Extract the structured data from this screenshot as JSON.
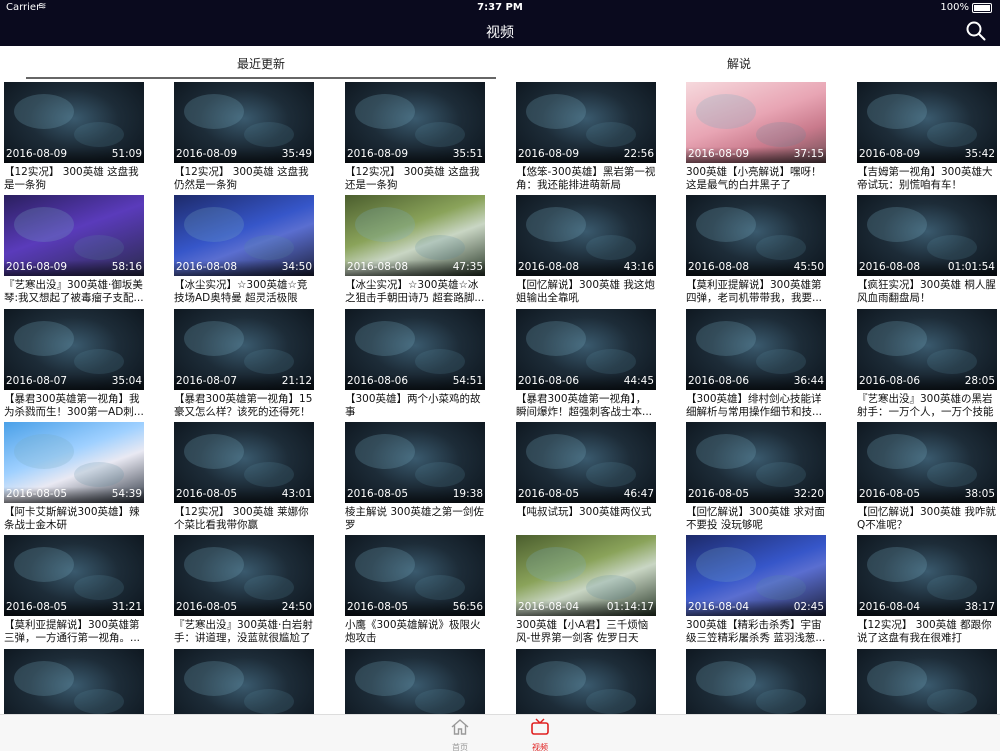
{
  "status": {
    "carrier": "Carrier",
    "time": "7:37 PM",
    "battery": "100%"
  },
  "nav": {
    "title": "视频"
  },
  "tabs": [
    {
      "label": "最近更新"
    },
    {
      "label": "解说"
    }
  ],
  "videos": [
    {
      "date": "2016-08-09",
      "duration": "51:09",
      "title": "【12实况】 300英雄 这盘我是一条狗"
    },
    {
      "date": "2016-08-09",
      "duration": "35:49",
      "title": "【12实况】 300英雄 这盘我仍然是一条狗"
    },
    {
      "date": "2016-08-09",
      "duration": "35:51",
      "title": "【12实况】 300英雄 这盘我还是一条狗"
    },
    {
      "date": "2016-08-09",
      "duration": "22:56",
      "title": "【悠笨-300英雄】黑岩第一视角：我还能排进萌新局"
    },
    {
      "date": "2016-08-09",
      "duration": "37:15",
      "title": "300英雄【小亮解说】嘿呀！这是最气的白井黑子了"
    },
    {
      "date": "2016-08-09",
      "duration": "35:42",
      "title": "【吉姆第一视角】300英雄大帝试玩：别慌咱有车！"
    },
    {
      "date": "2016-08-09",
      "duration": "58:16",
      "title": "『艺寒出没』300英雄·御坂美琴:我又想起了被毒瘤子支配..."
    },
    {
      "date": "2016-08-08",
      "duration": "34:50",
      "title": "【冰尘实况】☆300英雄☆竞技场AD奥特曼 超灵活极限秀..."
    },
    {
      "date": "2016-08-08",
      "duration": "47:35",
      "title": "【冰尘实况】☆300英雄☆冰之狙击手朝田诗乃 超套路脚..."
    },
    {
      "date": "2016-08-08",
      "duration": "43:16",
      "title": "【回忆解说】300英雄 我这炮姐输出全靠吼"
    },
    {
      "date": "2016-08-08",
      "duration": "45:50",
      "title": "【莫利亚提解说】300英雄第四弹，老司机带带我，我要..."
    },
    {
      "date": "2016-08-08",
      "duration": "01:01:54",
      "title": "【疯狂实况】300英雄 桐人腥风血雨翻盘局！"
    },
    {
      "date": "2016-08-07",
      "duration": "35:04",
      "title": "【暴君300英雄第一视角】我为杀戮而生！300第一AD刺..."
    },
    {
      "date": "2016-08-07",
      "duration": "21:12",
      "title": "【暴君300英雄第一视角】15豪又怎么样？该死的还得死！"
    },
    {
      "date": "2016-08-06",
      "duration": "54:51",
      "title": "【300英雄】两个小菜鸡的故事"
    },
    {
      "date": "2016-08-06",
      "duration": "44:45",
      "title": "【暴君300英雄第一视角】，瞬间爆炸！超强刺客战士本..."
    },
    {
      "date": "2016-08-06",
      "duration": "36:44",
      "title": "【300英雄】绯村剑心技能详细解析与常用操作细节和技..."
    },
    {
      "date": "2016-08-06",
      "duration": "28:05",
      "title": "『艺寒出没』300英雄の黑岩射手：一万个人，一万个技能"
    },
    {
      "date": "2016-08-05",
      "duration": "54:39",
      "title": "【阿卡艾斯解说300英雄】辣条战士金木研"
    },
    {
      "date": "2016-08-05",
      "duration": "43:01",
      "title": "【12实况】 300英雄 莱娜你个菜比看我带你赢"
    },
    {
      "date": "2016-08-05",
      "duration": "19:38",
      "title": "棱主解说 300英雄之第一剑佐罗"
    },
    {
      "date": "2016-08-05",
      "duration": "46:47",
      "title": "【吨叔试玩】300英雄两仪式"
    },
    {
      "date": "2016-08-05",
      "duration": "32:20",
      "title": "【回忆解说】300英雄 求对面不要投 没玩够呢"
    },
    {
      "date": "2016-08-05",
      "duration": "38:05",
      "title": "【回忆解说】300英雄 我咋就Q不准呢？"
    },
    {
      "date": "2016-08-05",
      "duration": "31:21",
      "title": "【莫利亚提解说】300英雄第三弹，一方通行第一视角。..."
    },
    {
      "date": "2016-08-05",
      "duration": "24:50",
      "title": "『艺寒出没』300英雄·白岩射手：讲道理，没蓝就很尴尬了"
    },
    {
      "date": "2016-08-05",
      "duration": "56:56",
      "title": "小鹰《300英雄解说》极限火炮攻击"
    },
    {
      "date": "2016-08-04",
      "duration": "01:14:17",
      "title": "300英雄【小A君】三千烦恼风-世界第一剑客 佐罗日天最..."
    },
    {
      "date": "2016-08-04",
      "duration": "02:45",
      "title": "300英雄【精彩击杀秀】宇宙级三笠精彩屠杀秀 蓝羽浅葱..."
    },
    {
      "date": "2016-08-04",
      "duration": "38:17",
      "title": "【12实况】 300英雄 都跟你说了这盘有我在很难打"
    },
    {
      "date": "",
      "duration": "",
      "title": ""
    },
    {
      "date": "",
      "duration": "",
      "title": ""
    },
    {
      "date": "",
      "duration": "",
      "title": ""
    },
    {
      "date": "",
      "duration": "",
      "title": ""
    },
    {
      "date": "",
      "duration": "",
      "title": ""
    },
    {
      "date": "",
      "duration": "",
      "title": ""
    }
  ],
  "tabbar": {
    "home": "首页",
    "video": "视频"
  },
  "icons": {
    "search": "search-icon",
    "home": "home-icon",
    "video": "tv-icon",
    "wifi": "wifi-icon",
    "battery": "battery-icon"
  },
  "colors": {
    "nav_bg": "#0a0a1e",
    "active": "#e02020",
    "inactive": "#999999"
  }
}
